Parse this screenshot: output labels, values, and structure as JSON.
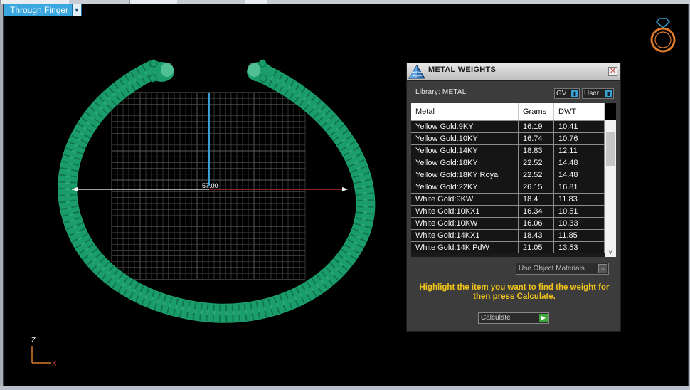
{
  "view": {
    "mode_label": "Through Finger"
  },
  "scene": {
    "dimension_label": "57.00",
    "axis_z_label": "Z",
    "axis_x_label": "X",
    "bangle_color": "#1a9c6b"
  },
  "panel": {
    "title": "METAL WEIGHTS",
    "library_label": "Library: METAL",
    "gv_toggle_label": "GV",
    "user_toggle_label": "User",
    "columns": [
      "Metal",
      "Grams",
      "DWT"
    ],
    "rows": [
      {
        "metal": "Yellow Gold:9KY",
        "grams": "16.19",
        "dwt": "10.41"
      },
      {
        "metal": "Yellow Gold:10KY",
        "grams": "16.74",
        "dwt": "10.76"
      },
      {
        "metal": "Yellow Gold:14KY",
        "grams": "18.83",
        "dwt": "12.11"
      },
      {
        "metal": "Yellow Gold:18KY",
        "grams": "22.52",
        "dwt": "14.48"
      },
      {
        "metal": "Yellow Gold:18KY Royal",
        "grams": "22.52",
        "dwt": "14.48"
      },
      {
        "metal": "Yellow Gold:22KY",
        "grams": "26.15",
        "dwt": "16.81"
      },
      {
        "metal": "White Gold:9KW",
        "grams": "18.4",
        "dwt": "11.83"
      },
      {
        "metal": "White Gold:10KX1",
        "grams": "16.34",
        "dwt": "10.51"
      },
      {
        "metal": "White Gold:10KW",
        "grams": "16.06",
        "dwt": "10.33"
      },
      {
        "metal": "White Gold:14KX1",
        "grams": "18.43",
        "dwt": "11.85"
      },
      {
        "metal": "White Gold:14K PdW",
        "grams": "21.05",
        "dwt": "13.53"
      }
    ],
    "use_object_materials_label": "Use Object Materials",
    "instruction": "Highlight the item you want to find the weight for then press Calculate.",
    "calculate_label": "Calculate",
    "accent_color": "#f0c419"
  }
}
